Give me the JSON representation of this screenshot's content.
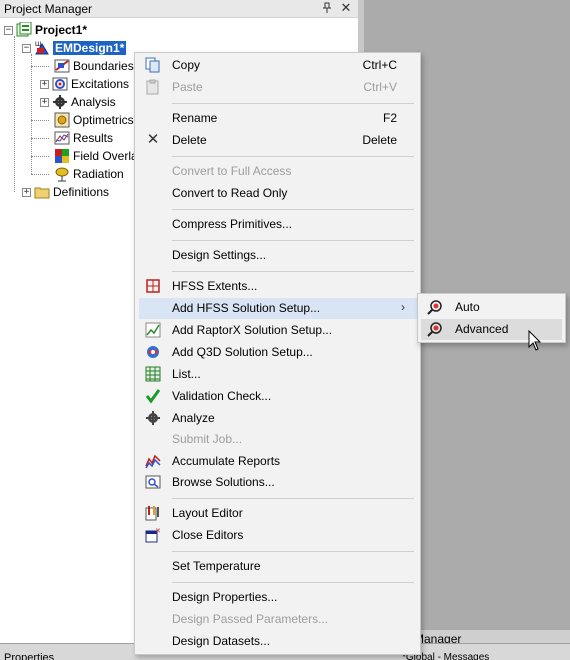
{
  "panel": {
    "title": "Project Manager",
    "pin_icon": "pin-icon",
    "close_icon": "close-icon"
  },
  "tree": {
    "project": "Project1*",
    "design": "EMDesign1*",
    "children": [
      "Boundaries",
      "Excitations",
      "Analysis",
      "Optimetrics",
      "Results",
      "Field Overla",
      "Radiation"
    ],
    "definitions": "Definitions"
  },
  "context_menu": {
    "items": [
      {
        "label": "Copy",
        "shortcut": "Ctrl+C",
        "icon": "copy-icon",
        "disabled": false
      },
      {
        "label": "Paste",
        "shortcut": "Ctrl+V",
        "icon": "paste-icon",
        "disabled": true
      },
      {
        "label": "Rename",
        "shortcut": "F2",
        "icon": "",
        "disabled": false
      },
      {
        "label": "Delete",
        "shortcut": "Delete",
        "icon": "delete-icon",
        "disabled": false
      },
      {
        "label": "Convert to Full Access",
        "shortcut": "",
        "icon": "",
        "disabled": true
      },
      {
        "label": "Convert to Read Only",
        "shortcut": "",
        "icon": "",
        "disabled": false
      },
      {
        "label": "Compress Primitives...",
        "shortcut": "",
        "icon": "",
        "disabled": false
      },
      {
        "label": "Design Settings...",
        "shortcut": "",
        "icon": "",
        "disabled": false
      },
      {
        "label": "HFSS Extents...",
        "shortcut": "",
        "icon": "hfss-extents-icon",
        "disabled": false
      },
      {
        "label": "Add HFSS Solution Setup...",
        "shortcut": "",
        "icon": "",
        "disabled": false
      },
      {
        "label": "Add RaptorX Solution Setup...",
        "shortcut": "",
        "icon": "raptorx-icon",
        "disabled": false
      },
      {
        "label": "Add Q3D Solution Setup...",
        "shortcut": "",
        "icon": "q3d-icon",
        "disabled": false
      },
      {
        "label": "List...",
        "shortcut": "",
        "icon": "list-icon",
        "disabled": false
      },
      {
        "label": "Validation Check...",
        "shortcut": "",
        "icon": "validation-check-icon",
        "disabled": false
      },
      {
        "label": "Analyze",
        "shortcut": "",
        "icon": "analyze-icon",
        "disabled": false
      },
      {
        "label": "Submit Job...",
        "shortcut": "",
        "icon": "",
        "disabled": true
      },
      {
        "label": "Accumulate Reports",
        "shortcut": "",
        "icon": "accumulate-reports-icon",
        "disabled": false
      },
      {
        "label": "Browse Solutions...",
        "shortcut": "",
        "icon": "browse-solutions-icon",
        "disabled": false
      },
      {
        "label": "Layout Editor",
        "shortcut": "",
        "icon": "layout-editor-icon",
        "disabled": false
      },
      {
        "label": "Close Editors",
        "shortcut": "",
        "icon": "close-editors-icon",
        "disabled": false
      },
      {
        "label": "Set Temperature",
        "shortcut": "",
        "icon": "",
        "disabled": false
      },
      {
        "label": "Design Properties...",
        "shortcut": "",
        "icon": "",
        "disabled": false
      },
      {
        "label": "Design Passed Parameters...",
        "shortcut": "",
        "icon": "",
        "disabled": true
      },
      {
        "label": "Design Datasets...",
        "shortcut": "",
        "icon": "",
        "disabled": false
      }
    ],
    "submenu_arrow": "›"
  },
  "submenu": {
    "items": [
      {
        "label": "Auto",
        "icon": "solution-setup-icon"
      },
      {
        "label": "Advanced",
        "icon": "solution-setup-icon"
      }
    ]
  },
  "bottom": {
    "properties_title": "Properties",
    "message_manager_title": "Manager",
    "message_row": "*Global - Messages"
  },
  "colors": {
    "selection": "#1d63c3",
    "menu_bg": "#f2f2f2",
    "hover": "#d9e5f4"
  }
}
